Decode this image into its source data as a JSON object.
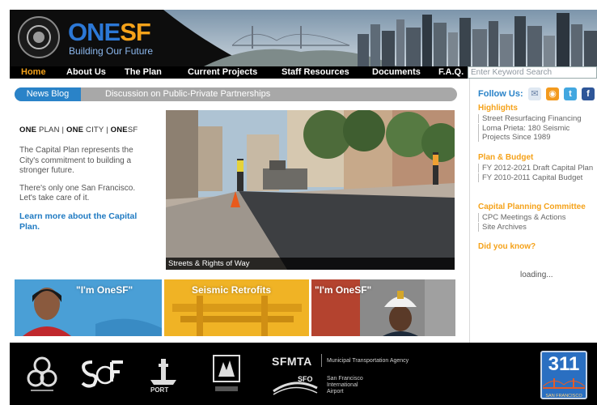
{
  "header": {
    "logo_one": "ONE",
    "logo_sf": "SF",
    "logo_tagline": "Building Our Future"
  },
  "nav": {
    "items": [
      {
        "label": "Home",
        "active": true
      },
      {
        "label": "About Us"
      },
      {
        "label": "The Plan"
      },
      {
        "label": "Current Projects"
      },
      {
        "label": "Staff Resources"
      },
      {
        "label": "Documents"
      },
      {
        "label": "F.A.Q."
      }
    ],
    "search_placeholder": "Enter Keyword Search"
  },
  "news": {
    "label": "News Blog",
    "headline": "Discussion on Public-Private Partnerships"
  },
  "intro": {
    "tagline_one": "ONE",
    "tagline_plan": "PLAN | ",
    "tagline_one2": "ONE",
    "tagline_city": " CITY | ",
    "tagline_one3": "ONE",
    "tagline_sf": "SF",
    "paragraph1": "The Capital Plan represents the City's commitment to building a stronger future.",
    "paragraph2": "There's only one San Francisco. Let's take care of it.",
    "learn_more": "Learn more about the Capital Plan."
  },
  "hero": {
    "caption": "Streets & Rights of Way"
  },
  "promos": [
    {
      "title": "\"I'm OneSF\"",
      "color": "#4a9fd6"
    },
    {
      "title": "Seismic Retrofits",
      "color": "#f0b325"
    },
    {
      "title": "\"I'm OneSF\"",
      "color": "#6d6d6d"
    }
  ],
  "sidebar": {
    "follow_label": "Follow Us:",
    "social_icons": [
      "email-icon",
      "rss-icon",
      "twitter-icon",
      "facebook-icon"
    ],
    "sections": [
      {
        "heading": "Highlights",
        "links": [
          "Street Resurfacing Financing",
          "Loma Prieta: 180 Seismic Projects Since 1989"
        ]
      },
      {
        "heading": "Plan & Budget",
        "links": [
          "FY 2012-2021 Draft Capital Plan",
          "FY 2010-2011 Capital Budget"
        ]
      },
      {
        "heading": "Capital Planning Committee",
        "links": [
          "CPC Meetings & Actions",
          "Site Archives"
        ]
      },
      {
        "heading": "Did you know?",
        "links": []
      }
    ],
    "loading": "loading..."
  },
  "footer": {
    "sfmta_name": "SFMTA",
    "sfmta_desc": "Municipal Transportation Agency",
    "sfo_name": "SFO",
    "sfo_desc": "San Francisco International Airport",
    "port_name": "PORT",
    "three11_number": "311",
    "three11_sub": "SAN FRANCISCO"
  },
  "colors": {
    "brand_blue": "#2c78d6",
    "brand_orange": "#f5a21a",
    "news_blue": "#2a83c8",
    "link_blue": "#1f7ac2"
  }
}
